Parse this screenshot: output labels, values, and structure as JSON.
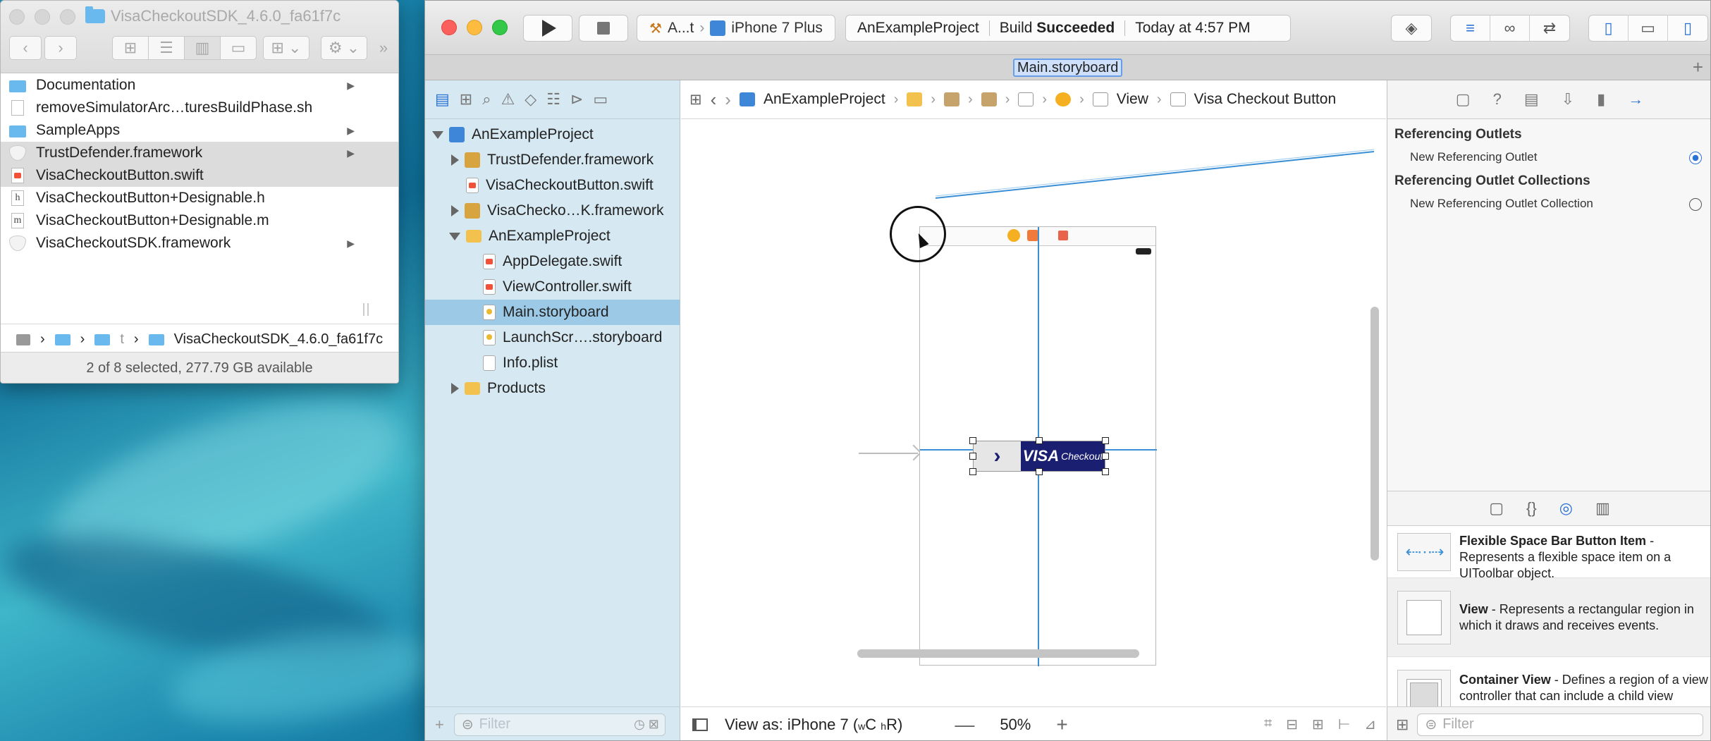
{
  "finder": {
    "title": "VisaCheckoutSDK_4.6.0_fa61f7c",
    "toolbar": {
      "back": "‹",
      "forward": "›",
      "view_icons": "⊞",
      "view_list": "☰",
      "view_columns": "▥",
      "view_gallery": "▭",
      "group": "⊞ ⌄",
      "action": "⚙ ⌄",
      "more": "»"
    },
    "items": [
      {
        "name": "Documentation",
        "kind": "folder",
        "expandable": true,
        "selected": false
      },
      {
        "name": "removeSimulatorArc…turesBuildPhase.sh",
        "kind": "doc",
        "expandable": false,
        "selected": false
      },
      {
        "name": "SampleApps",
        "kind": "folder",
        "expandable": true,
        "selected": false
      },
      {
        "name": "TrustDefender.framework",
        "kind": "framework",
        "expandable": true,
        "selected": true
      },
      {
        "name": "VisaCheckoutButton.swift",
        "kind": "swift",
        "expandable": false,
        "selected": true
      },
      {
        "name": "VisaCheckoutButton+Designable.h",
        "kind": "h",
        "expandable": false,
        "selected": false
      },
      {
        "name": "VisaCheckoutButton+Designable.m",
        "kind": "m",
        "expandable": false,
        "selected": false
      },
      {
        "name": "VisaCheckoutSDK.framework",
        "kind": "framework",
        "expandable": true,
        "selected": false
      }
    ],
    "path": {
      "sep": "›",
      "segment_t": "t",
      "current": "VisaCheckoutSDK_4.6.0_fa61f7c"
    },
    "status": "2 of 8 selected, 277.79 GB available"
  },
  "xcode": {
    "toolbar": {
      "scheme_target": "A...t",
      "scheme_device": "iPhone 7 Plus",
      "scheme_sep": "›",
      "activity_project": "AnExampleProject",
      "activity_build_prefix": "Build",
      "activity_build_status": "Succeeded",
      "activity_time": "Today at 4:57 PM",
      "icons": [
        "◈",
        "≡",
        "∞",
        "⇄",
        "▯",
        "▭",
        "▯"
      ]
    },
    "tab": {
      "label": "Main.storyboard",
      "plus": "+"
    },
    "navigator": {
      "icons": [
        "▤",
        "⊞",
        "⌕",
        "⚠",
        "◇",
        "☷",
        "⊳",
        "▭"
      ],
      "rows": [
        {
          "label": "AnExampleProject",
          "indent": 0,
          "tri": "down",
          "icon": "proj",
          "selected": false
        },
        {
          "label": "TrustDefender.framework",
          "indent": 1,
          "tri": "right",
          "icon": "box",
          "selected": false
        },
        {
          "label": "VisaCheckoutButton.swift",
          "indent": 1,
          "tri": "none",
          "icon": "swf",
          "selected": false
        },
        {
          "label": "VisaChecko…K.framework",
          "indent": 1,
          "tri": "right",
          "icon": "box",
          "selected": false
        },
        {
          "label": "AnExampleProject",
          "indent": 1,
          "tri": "down",
          "icon": "fold",
          "selected": false
        },
        {
          "label": "AppDelegate.swift",
          "indent": 2,
          "tri": "none",
          "icon": "swf",
          "selected": false
        },
        {
          "label": "ViewController.swift",
          "indent": 2,
          "tri": "none",
          "icon": "swf",
          "selected": false
        },
        {
          "label": "Main.storyboard",
          "indent": 2,
          "tri": "none",
          "icon": "sb",
          "selected": true
        },
        {
          "label": "LaunchScr….storyboard",
          "indent": 2,
          "tri": "none",
          "icon": "sb",
          "selected": false
        },
        {
          "label": "Info.plist",
          "indent": 2,
          "tri": "none",
          "icon": "plist",
          "selected": false
        },
        {
          "label": "Products",
          "indent": 1,
          "tri": "right",
          "icon": "fold",
          "selected": false
        }
      ],
      "add": "+",
      "filter_placeholder": "Filter"
    },
    "editor": {
      "jumpbar": {
        "grid": "⊞",
        "back": "‹",
        "forward": "›",
        "project": "AnExampleProject",
        "view": "View",
        "button": "Visa Checkout Button"
      },
      "visa": {
        "chevron": "›",
        "wordmark": "VISA",
        "checkout": "Checkout"
      },
      "bottom": {
        "view_as": "View as: iPhone 7 (",
        "size_class_w": "w",
        "size_class_c": "C",
        "size_class_h": "h",
        "size_class_r": "R)",
        "zoom_out": "—",
        "zoom": "50%",
        "zoom_in": "+",
        "layout_icons": [
          "⌗",
          "⊟",
          "⊞",
          "⊢",
          "⊿"
        ]
      }
    },
    "inspector": {
      "tabs": [
        "▢",
        "?",
        "▤",
        "⇩",
        "▮",
        "→"
      ],
      "referencing_outlets": "Referencing Outlets",
      "new_referencing_outlet": "New Referencing Outlet",
      "referencing_outlet_collections": "Referencing Outlet Collections",
      "new_referencing_outlet_collection": "New Referencing Outlet Collection",
      "library_tabs": [
        "▢",
        "{}",
        "◎",
        "▥"
      ],
      "library": [
        {
          "title": "Flexible Space Bar Button Item",
          "desc": " - Represents a flexible space item on a UIToolbar object."
        },
        {
          "title": "View",
          "desc": " - Represents a rectangular region in which it draws and receives events."
        },
        {
          "title": "Container View",
          "desc": " - Defines a region of a view controller that can include a child view controller."
        }
      ],
      "filter_placeholder": "Filter"
    },
    "colors": {
      "accent": "#2a72d6",
      "visa_navy": "#1a1f71",
      "selection": "#9cc9e6",
      "constraint": "#3a8fd5"
    }
  }
}
